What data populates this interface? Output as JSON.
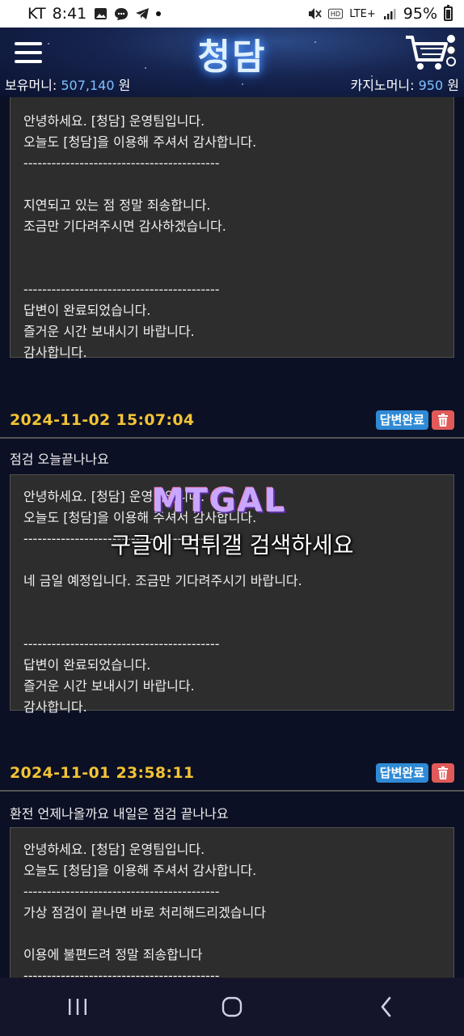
{
  "status_bar": {
    "carrier": "KT",
    "time": "8:41",
    "network": "LTE+",
    "battery": "95%"
  },
  "header": {
    "logo_text": "청담",
    "held_money_label": "보유머니:",
    "held_money_value": "507,140",
    "held_money_unit": "원",
    "casino_money_label": "카지노머니:",
    "casino_money_value": "950",
    "casino_money_unit": "원"
  },
  "posts": [
    {
      "answer_lines": [
        "안녕하세요. [청담] 운영팀입니다.",
        "오늘도 [청담]을 이용해 주셔서 감사합니다.",
        "------------------------------------------",
        "",
        "지연되고 있는 점 정말 죄송합니다.",
        "조금만 기다려주시면 감사하겠습니다.",
        "",
        "",
        "------------------------------------------",
        "답변이 완료되었습니다.",
        "즐거운 시간 보내시기 바랍니다.",
        "감사합니다."
      ]
    },
    {
      "date": "2024-11-02 15:07:04",
      "status": "답변완료",
      "title": "점검 오늘끝나나요",
      "answer_lines": [
        "안녕하세요. [청담] 운영팀입니다.",
        "오늘도 [청담]을 이용해 주셔서 감사합니다.",
        "------------------------------------------",
        "",
        "네 금일 예정입니다. 조금만 기다려주시기 바랍니다.",
        "",
        "",
        "------------------------------------------",
        "답변이 완료되었습니다.",
        "즐거운 시간 보내시기 바랍니다.",
        "감사합니다."
      ]
    },
    {
      "date": "2024-11-01 23:58:11",
      "status": "답변완료",
      "title": "환전 언제나올까요 내일은 점검 끝나나요",
      "answer_lines": [
        "안녕하세요. [청담] 운영팀입니다.",
        "오늘도 [청담]을 이용해 주셔서 감사합니다.",
        "------------------------------------------",
        "가상 점검이 끝나면 바로 처리해드리겠습니다",
        "",
        "이용에 불편드려 정말 죄송합니다",
        "------------------------------------------"
      ]
    }
  ],
  "watermark": {
    "logo": "MTGAL",
    "text": "구글에 먹튀갤 검색하세요"
  },
  "colors": {
    "date": "#f2c335",
    "badge": "#2f8ad6",
    "delete": "#e05a5a",
    "money_value": "#7ec0ff"
  },
  "icons": {
    "menu": "hamburger-icon",
    "cart": "cart-icon",
    "delete": "trash-icon",
    "nav_recent": "recent-apps-icon",
    "nav_home": "home-icon",
    "nav_back": "back-icon"
  }
}
